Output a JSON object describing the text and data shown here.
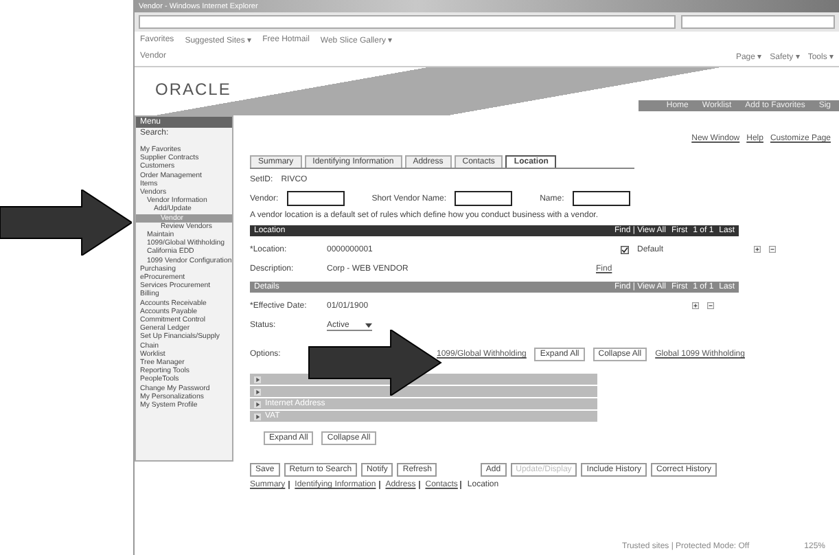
{
  "window": {
    "title": "Vendor - Windows Internet Explorer"
  },
  "favorites_bar": {
    "favorites": "Favorites",
    "items": [
      "Suggested Sites ▾",
      "Free Hotmail",
      "Web Slice Gallery ▾"
    ]
  },
  "browser_tab": {
    "title": "Vendor"
  },
  "command_bar": [
    "Page ▾",
    "Safety ▾",
    "Tools ▾"
  ],
  "header": {
    "logo": "ORACLE",
    "links": [
      "Home",
      "Worklist",
      "Add to Favorites",
      "Sig"
    ]
  },
  "menu": {
    "title": "Menu",
    "search_label": "Search:",
    "items": [
      {
        "label": "My Favorites",
        "selected": false
      },
      {
        "label": "Supplier Contracts",
        "selected": false
      },
      {
        "label": "Customers",
        "selected": false
      },
      {
        "label": "Order Management",
        "selected": false
      },
      {
        "label": "Items",
        "selected": false
      },
      {
        "label": "Vendors",
        "selected": false,
        "children": [
          {
            "label": "Vendor Information",
            "selected": false,
            "children": [
              {
                "label": "Add/Update",
                "selected": false,
                "children": [
                  {
                    "label": "Vendor",
                    "selected": true
                  },
                  {
                    "label": "Review Vendors",
                    "selected": false
                  }
                ]
              }
            ]
          },
          {
            "label": "Maintain",
            "selected": false
          },
          {
            "label": "1099/Global Withholding",
            "selected": false
          },
          {
            "label": "California EDD",
            "selected": false
          },
          {
            "label": "1099 Vendor Configuration",
            "selected": false
          }
        ]
      },
      {
        "label": "Purchasing",
        "selected": false
      },
      {
        "label": "eProcurement",
        "selected": false
      },
      {
        "label": "Services Procurement",
        "selected": false
      },
      {
        "label": "Billing",
        "selected": false
      },
      {
        "label": "Accounts Receivable",
        "selected": false
      },
      {
        "label": "Accounts Payable",
        "selected": false
      },
      {
        "label": "Commitment Control",
        "selected": false
      },
      {
        "label": "General Ledger",
        "selected": false
      },
      {
        "label": "Set Up Financials/Supply Chain",
        "selected": false
      },
      {
        "label": "Worklist",
        "selected": false
      },
      {
        "label": "Tree Manager",
        "selected": false
      },
      {
        "label": "Reporting Tools",
        "selected": false
      },
      {
        "label": "PeopleTools",
        "selected": false
      },
      {
        "label": "Change My Password",
        "selected": false
      },
      {
        "label": "My Personalizations",
        "selected": false
      },
      {
        "label": "My System Profile",
        "selected": false
      }
    ]
  },
  "page_links": [
    "New Window",
    "Help",
    "Customize Page"
  ],
  "tabs": [
    {
      "label": "Summary",
      "selected": false
    },
    {
      "label": "Identifying Information",
      "selected": false
    },
    {
      "label": "Address",
      "selected": false
    },
    {
      "label": "Contacts",
      "selected": false
    },
    {
      "label": "Location",
      "selected": true
    }
  ],
  "setid": {
    "label": "SetID:",
    "value": "RIVCO"
  },
  "keys": [
    {
      "label": "Vendor:"
    },
    {
      "label": "Short Vendor Name:"
    },
    {
      "label": "Name:"
    }
  ],
  "intro": "A vendor location is a default set of rules which define how you conduct business with a vendor.",
  "location_bar": {
    "title": "Location",
    "nav": "Find | View All",
    "first": "First",
    "count": "1 of 1",
    "last": "Last"
  },
  "location": {
    "label": "*Location:",
    "value": "0000000001",
    "default_label": "Default",
    "default_checked": true,
    "description_label": "Description:",
    "description": "Corp - WEB VENDOR",
    "find": "Find"
  },
  "details_bar": {
    "title": "Details",
    "nav": "Find | View All",
    "first": "First",
    "count": "1 of 1",
    "last": "Last"
  },
  "details": {
    "date_label": "*Effective Date:",
    "date": "01/01/1900",
    "status_label": "Status:",
    "status": "Active",
    "options_label": "Options:",
    "withholding_link": "1099/Global Withholding",
    "expand": "Expand All",
    "collapse": "Collapse All",
    "global_link": "Global 1099 Withholding"
  },
  "sections": [
    {
      "expanded": false
    },
    {
      "expanded": false
    },
    {
      "title": "Internet Address",
      "expanded": false
    },
    {
      "title": "VAT",
      "expanded": false
    }
  ],
  "section_buttons": [
    "Expand All",
    "Collapse All"
  ],
  "toolbar_left": [
    {
      "label": "Save",
      "disabled": false
    },
    {
      "label": "Return to Search",
      "disabled": false
    },
    {
      "label": "Notify",
      "disabled": false
    },
    {
      "label": "Refresh",
      "disabled": false
    }
  ],
  "toolbar_right": [
    {
      "label": "Add",
      "disabled": false
    },
    {
      "label": "Update/Display",
      "disabled": true
    },
    {
      "label": "Include History",
      "disabled": false
    },
    {
      "label": "Correct History",
      "disabled": false
    }
  ],
  "bottom_links": [
    "Summary",
    "Identifying Information",
    "Address",
    "Contacts",
    "Location"
  ],
  "status_bar": {
    "zone": "Trusted sites | Protected Mode: Off",
    "zoom": "125%"
  }
}
